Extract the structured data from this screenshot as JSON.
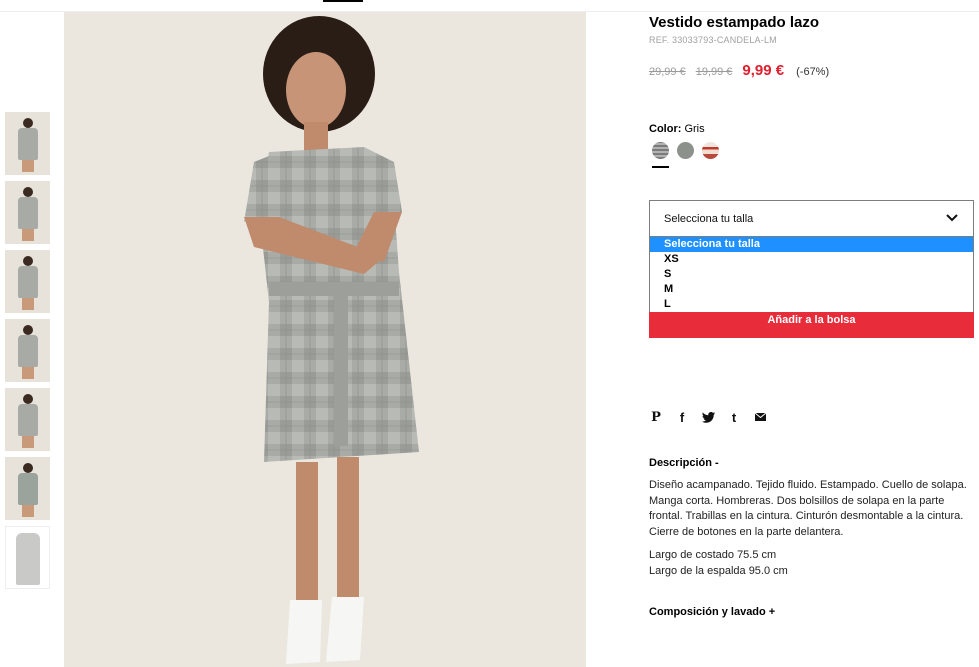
{
  "product": {
    "title": "Vestido estampado lazo",
    "ref": "REF. 33033793-CANDELA-LM",
    "price_original": "29,99 €",
    "price_previous": "19,99 €",
    "price_current": "9,99 €",
    "discount": "(-67%)"
  },
  "color": {
    "label": "Color:",
    "value": "Gris",
    "swatches": [
      "gris-check",
      "gris-verde",
      "rosa-estampado"
    ]
  },
  "size": {
    "placeholder": "Selecciona tu talla",
    "options": [
      "Selecciona tu talla",
      "XS",
      "S",
      "M",
      "L"
    ]
  },
  "cart": {
    "add_label": "Añadir a la bolsa"
  },
  "share": {
    "icons": [
      "pinterest-icon",
      "facebook-icon",
      "twitter-icon",
      "tumblr-icon",
      "email-icon"
    ],
    "glyphs": {
      "pinterest": "P",
      "facebook": "f",
      "twitter": "t",
      "tumblr": "t"
    }
  },
  "description": {
    "heading": "Descripción -",
    "body": "Diseño acampanado. Tejido fluido. Estampado. Cuello de solapa. Manga corta. Hombreras. Dos bolsillos de solapa en la parte frontal. Trabillas en la cintura. Cinturón desmontable a la cintura. Cierre de botones en la parte delantera.",
    "measure_1": "Largo de costado 75.5 cm",
    "measure_2": "Largo de la espalda 95.0 cm"
  },
  "composition": {
    "heading": "Composición y lavado +"
  },
  "colors": {
    "price_red": "#e01f2f",
    "button_red": "#e82c3a",
    "select_blue": "#1e90ff",
    "hero_bg": "#ebe7df"
  }
}
